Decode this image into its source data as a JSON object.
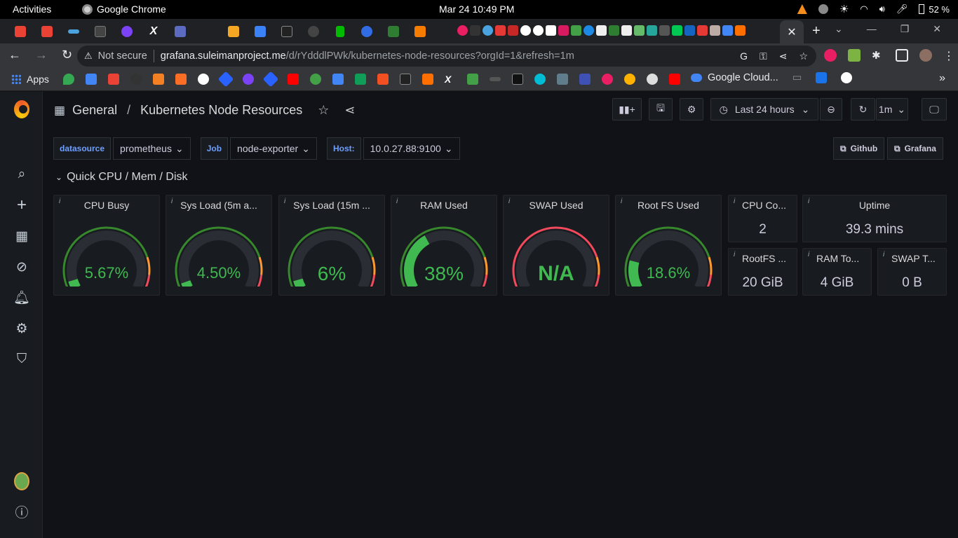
{
  "os": {
    "activities": "Activities",
    "app_name": "Google Chrome",
    "clock": "Mar 24  10:49 PM",
    "battery": "52 %"
  },
  "browser": {
    "not_secure": "Not secure",
    "url_host": "grafana.suleimanproject.me",
    "url_path": "/d/rYdddlPWk/kubernetes-node-resources?orgId=1&refresh=1m",
    "bookmarks_apps": "Apps",
    "bookmark_google_cloud": "Google Cloud..."
  },
  "dashboard": {
    "folder": "General",
    "title": "Kubernetes Node Resources",
    "time_range": "Last 24 hours",
    "refresh_interval": "1m",
    "variables": [
      {
        "label": "datasource",
        "value": "prometheus"
      },
      {
        "label": "Job",
        "value": "node-exporter"
      },
      {
        "label": "Host:",
        "value": "10.0.27.88:9100"
      }
    ],
    "links": {
      "github": "Github",
      "grafana": "Grafana"
    },
    "row_title": "Quick CPU / Mem / Disk",
    "gauges": [
      {
        "title": "CPU Busy",
        "value": "5.67%",
        "level": 0.0567
      },
      {
        "title": "Sys Load (5m a...",
        "value": "4.50%",
        "level": 0.045
      },
      {
        "title": "Sys Load (15m ...",
        "value": "6%",
        "level": 0.06
      },
      {
        "title": "RAM Used",
        "value": "38%",
        "level": 0.38
      },
      {
        "title": "SWAP Used",
        "value": "N/A",
        "level": 0
      },
      {
        "title": "Root FS Used",
        "value": "18.6%",
        "level": 0.186
      }
    ],
    "stats": [
      {
        "title": "CPU Co...",
        "value": "2"
      },
      {
        "title": "Uptime",
        "value": "39.3 mins"
      },
      {
        "title": "RootFS ...",
        "value": "20 GiB"
      },
      {
        "title": "RAM To...",
        "value": "4 GiB"
      },
      {
        "title": "SWAP T...",
        "value": "0 B"
      }
    ],
    "colors": {
      "green": "#37872d",
      "bright_green": "#3fb950",
      "orange": "#ff9830",
      "red": "#f2495c"
    }
  }
}
